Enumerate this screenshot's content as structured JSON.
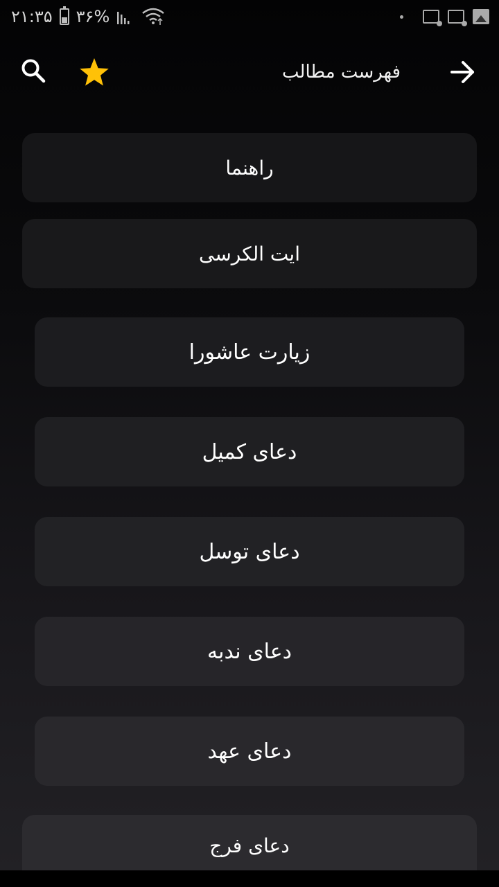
{
  "status_bar": {
    "time": "۲۱:۳۵",
    "battery": "۳۶%"
  },
  "app_bar": {
    "title": "فهرست مطالب",
    "icons": [
      "arrow-forward-icon",
      "star-icon",
      "search-icon"
    ],
    "star_color": "#FFC107"
  },
  "list": {
    "items": [
      {
        "label": "راهنما"
      },
      {
        "label": "ایت الکرسی"
      },
      {
        "label": "زیارت عاشورا"
      },
      {
        "label": "دعای کمیل"
      },
      {
        "label": "دعای توسل"
      },
      {
        "label": "دعای ندبه"
      },
      {
        "label": "دعای عهد"
      },
      {
        "label": "دعای فرج"
      }
    ]
  }
}
